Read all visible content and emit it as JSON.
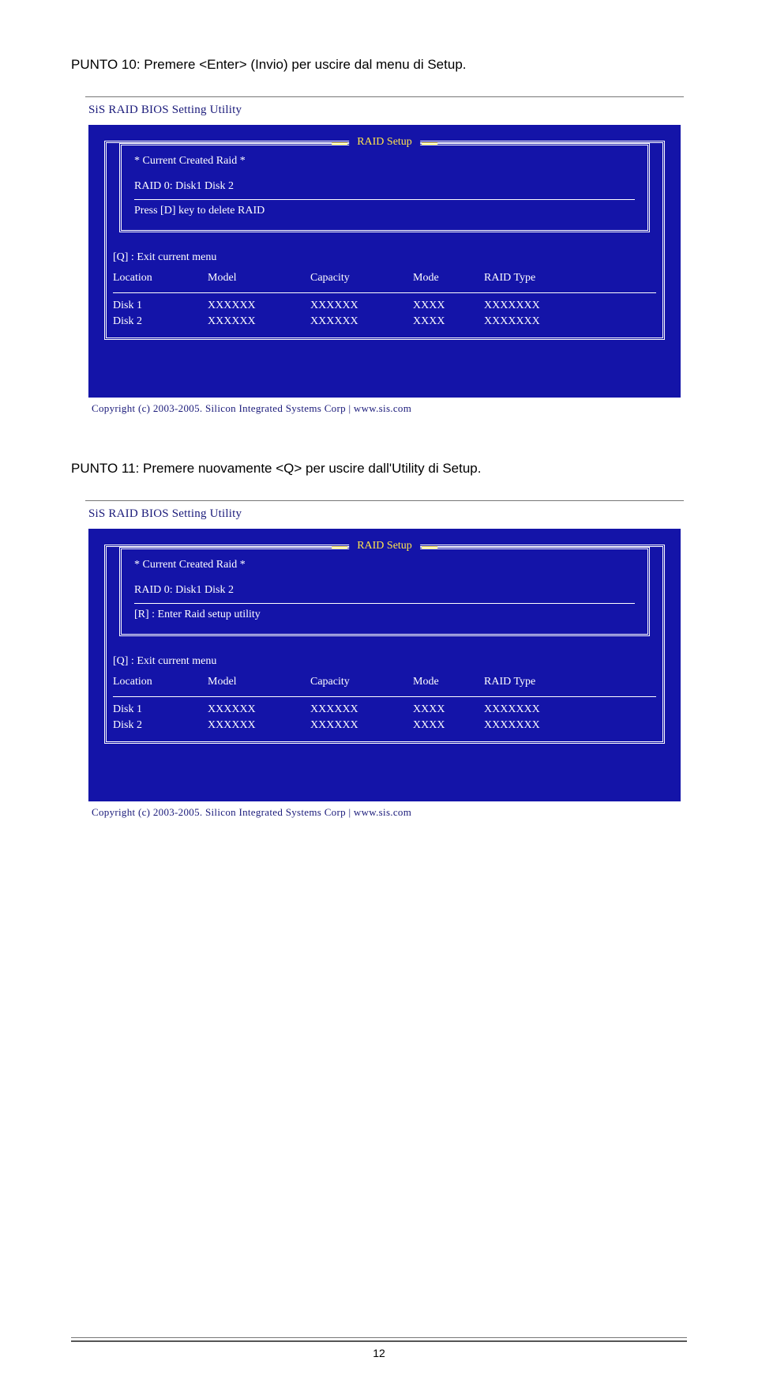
{
  "steps": [
    {
      "label": "PUNTO 10:",
      "text": "Premere <Enter> (Invio) per uscire dal menu di Setup."
    },
    {
      "label": "PUNTO 11:",
      "text": "Premere nuovamente <Q> per uscire dall'Utility di Setup."
    }
  ],
  "bios": {
    "title": "SiS RAID BIOS Setting Utility",
    "raid_setup_label": "RAID Setup",
    "current_created": "* Current Created Raid *",
    "raid0_line": "RAID 0:  Disk1    Disk 2",
    "press_d": "Press [D] key to delete RAID",
    "enter_r": "[R]  :  Enter Raid setup utility",
    "exit_q": "[Q]  :  Exit current menu",
    "table": {
      "headers": {
        "location": "Location",
        "model": "Model",
        "capacity": "Capacity",
        "mode": "Mode",
        "type": "RAID Type"
      },
      "rows": [
        {
          "location": "Disk 1",
          "model": "XXXXXX",
          "capacity": "XXXXXX",
          "mode": "XXXX",
          "type": "XXXXXXX"
        },
        {
          "location": "Disk 2",
          "model": "XXXXXX",
          "capacity": "XXXXXX",
          "mode": "XXXX",
          "type": "XXXXXXX"
        }
      ]
    },
    "copyright": "Copyright (c) 2003-2005. Silicon Integrated Systems Corp  |  www.sis.com"
  },
  "page_number": "12"
}
